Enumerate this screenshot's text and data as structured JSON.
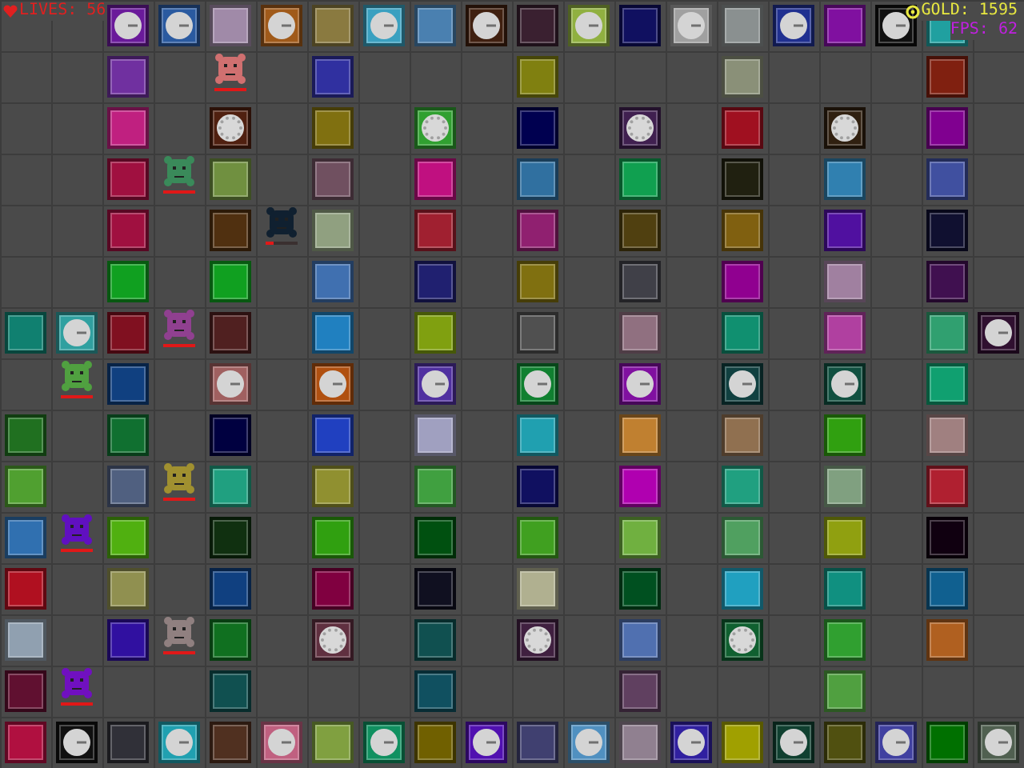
{
  "hud": {
    "lives": "LIVES: 56",
    "gold": "GOLD: 1595",
    "fps": "FPS: 62"
  },
  "grid": [
    [
      {
        "kind": "empty"
      },
      {
        "kind": "empty"
      },
      {
        "kind": "clock",
        "color": "#6a1a9a"
      },
      {
        "kind": "clock",
        "color": "#2a5aa0"
      },
      {
        "kind": "tile",
        "color": "#a08aa8"
      },
      {
        "kind": "clock",
        "color": "#a05a1a"
      },
      {
        "kind": "tile",
        "color": "#8a7a40"
      },
      {
        "kind": "clock",
        "color": "#3aa0c0"
      },
      {
        "kind": "tile",
        "color": "#4a80b0"
      },
      {
        "kind": "clock",
        "color": "#402010"
      },
      {
        "kind": "tile",
        "color": "#3a2030"
      },
      {
        "kind": "clock",
        "color": "#90b040"
      },
      {
        "kind": "tile",
        "color": "#101060"
      },
      {
        "kind": "clock",
        "color": "#a0a0a0"
      },
      {
        "kind": "tile",
        "color": "#8a9090"
      },
      {
        "kind": "clock",
        "color": "#203090"
      },
      {
        "kind": "tile",
        "color": "#8010a0"
      },
      {
        "kind": "clock",
        "color": "#101010"
      },
      {
        "kind": "tile",
        "color": "#20a0a0"
      },
      {
        "kind": "empty"
      }
    ],
    [
      {
        "kind": "empty"
      },
      {
        "kind": "empty"
      },
      {
        "kind": "tile",
        "color": "#7030a0"
      },
      {
        "kind": "empty"
      },
      {
        "kind": "empty",
        "creep": {
          "color": "#d07070",
          "level": 1
        }
      },
      {
        "kind": "empty"
      },
      {
        "kind": "tile",
        "color": "#3030a0"
      },
      {
        "kind": "empty"
      },
      {
        "kind": "empty"
      },
      {
        "kind": "empty"
      },
      {
        "kind": "tile",
        "color": "#808010"
      },
      {
        "kind": "empty"
      },
      {
        "kind": "empty"
      },
      {
        "kind": "empty"
      },
      {
        "kind": "tile",
        "color": "#8a9078"
      },
      {
        "kind": "empty"
      },
      {
        "kind": "empty"
      },
      {
        "kind": "empty"
      },
      {
        "kind": "tile",
        "color": "#802010"
      },
      {
        "kind": "empty"
      }
    ],
    [
      {
        "kind": "empty"
      },
      {
        "kind": "empty"
      },
      {
        "kind": "tile",
        "color": "#c02080"
      },
      {
        "kind": "empty"
      },
      {
        "kind": "dial",
        "color": "#502010"
      },
      {
        "kind": "empty"
      },
      {
        "kind": "tile",
        "color": "#807010"
      },
      {
        "kind": "empty"
      },
      {
        "kind": "dial",
        "color": "#30a030"
      },
      {
        "kind": "empty"
      },
      {
        "kind": "tile",
        "color": "#000050"
      },
      {
        "kind": "empty"
      },
      {
        "kind": "dial",
        "color": "#402050"
      },
      {
        "kind": "empty"
      },
      {
        "kind": "tile",
        "color": "#a01020"
      },
      {
        "kind": "empty"
      },
      {
        "kind": "dial",
        "color": "#302010"
      },
      {
        "kind": "empty"
      },
      {
        "kind": "tile",
        "color": "#800090"
      },
      {
        "kind": "empty"
      }
    ],
    [
      {
        "kind": "empty"
      },
      {
        "kind": "empty"
      },
      {
        "kind": "tile",
        "color": "#a01040"
      },
      {
        "kind": "empty",
        "creep": {
          "color": "#3a8a5a",
          "level": 1
        }
      },
      {
        "kind": "tile",
        "color": "#709040"
      },
      {
        "kind": "empty"
      },
      {
        "kind": "tile",
        "color": "#705060"
      },
      {
        "kind": "empty"
      },
      {
        "kind": "tile",
        "color": "#c01080"
      },
      {
        "kind": "empty"
      },
      {
        "kind": "tile",
        "color": "#3070a0"
      },
      {
        "kind": "empty"
      },
      {
        "kind": "tile",
        "color": "#10a050"
      },
      {
        "kind": "empty"
      },
      {
        "kind": "tile",
        "color": "#202010"
      },
      {
        "kind": "empty"
      },
      {
        "kind": "tile",
        "color": "#3080b0"
      },
      {
        "kind": "empty"
      },
      {
        "kind": "tile",
        "color": "#4050a0"
      },
      {
        "kind": "empty"
      }
    ],
    [
      {
        "kind": "empty"
      },
      {
        "kind": "empty"
      },
      {
        "kind": "tile",
        "color": "#a01040"
      },
      {
        "kind": "empty"
      },
      {
        "kind": "tile",
        "color": "#503010"
      },
      {
        "kind": "empty",
        "creep": {
          "color": "#102030",
          "level": 0.25
        }
      },
      {
        "kind": "tile",
        "color": "#90a080"
      },
      {
        "kind": "empty"
      },
      {
        "kind": "tile",
        "color": "#a02030"
      },
      {
        "kind": "empty"
      },
      {
        "kind": "tile",
        "color": "#902070"
      },
      {
        "kind": "empty"
      },
      {
        "kind": "tile",
        "color": "#504010"
      },
      {
        "kind": "empty"
      },
      {
        "kind": "tile",
        "color": "#806010"
      },
      {
        "kind": "empty"
      },
      {
        "kind": "tile",
        "color": "#5010a0"
      },
      {
        "kind": "empty"
      },
      {
        "kind": "tile",
        "color": "#101030"
      },
      {
        "kind": "empty"
      }
    ],
    [
      {
        "kind": "empty"
      },
      {
        "kind": "empty"
      },
      {
        "kind": "tile",
        "color": "#10a020"
      },
      {
        "kind": "empty"
      },
      {
        "kind": "tile",
        "color": "#10a020"
      },
      {
        "kind": "empty"
      },
      {
        "kind": "tile",
        "color": "#4070b0"
      },
      {
        "kind": "empty"
      },
      {
        "kind": "tile",
        "color": "#202070"
      },
      {
        "kind": "empty"
      },
      {
        "kind": "tile",
        "color": "#807010"
      },
      {
        "kind": "empty"
      },
      {
        "kind": "tile",
        "color": "#404048"
      },
      {
        "kind": "empty"
      },
      {
        "kind": "tile",
        "color": "#900090"
      },
      {
        "kind": "empty"
      },
      {
        "kind": "tile",
        "color": "#a080a0"
      },
      {
        "kind": "empty"
      },
      {
        "kind": "tile",
        "color": "#401050"
      },
      {
        "kind": "empty"
      }
    ],
    [
      {
        "kind": "tile",
        "color": "#108070"
      },
      {
        "kind": "clock",
        "color": "#30a0a0"
      },
      {
        "kind": "tile",
        "color": "#801020"
      },
      {
        "kind": "empty",
        "creep": {
          "color": "#904090",
          "level": 1
        }
      },
      {
        "kind": "tile",
        "color": "#502020"
      },
      {
        "kind": "empty"
      },
      {
        "kind": "tile",
        "color": "#2080c0"
      },
      {
        "kind": "empty"
      },
      {
        "kind": "tile",
        "color": "#80a010"
      },
      {
        "kind": "empty"
      },
      {
        "kind": "tile",
        "color": "#505050"
      },
      {
        "kind": "empty"
      },
      {
        "kind": "tile",
        "color": "#907080"
      },
      {
        "kind": "empty"
      },
      {
        "kind": "tile",
        "color": "#109070"
      },
      {
        "kind": "empty"
      },
      {
        "kind": "tile",
        "color": "#b040a0"
      },
      {
        "kind": "empty"
      },
      {
        "kind": "tile",
        "color": "#30a070"
      },
      {
        "kind": "clock",
        "color": "#301030"
      }
    ],
    [
      {
        "kind": "empty"
      },
      {
        "kind": "empty",
        "creep": {
          "color": "#50a040",
          "level": 1
        }
      },
      {
        "kind": "tile",
        "color": "#104080"
      },
      {
        "kind": "empty"
      },
      {
        "kind": "clock",
        "color": "#a06060"
      },
      {
        "kind": "empty"
      },
      {
        "kind": "clock",
        "color": "#b05010"
      },
      {
        "kind": "empty"
      },
      {
        "kind": "clock",
        "color": "#5030a0"
      },
      {
        "kind": "empty"
      },
      {
        "kind": "clock",
        "color": "#108030"
      },
      {
        "kind": "empty"
      },
      {
        "kind": "clock",
        "color": "#8010a0"
      },
      {
        "kind": "empty"
      },
      {
        "kind": "clock",
        "color": "#104040"
      },
      {
        "kind": "empty"
      },
      {
        "kind": "clock",
        "color": "#105040"
      },
      {
        "kind": "empty"
      },
      {
        "kind": "tile",
        "color": "#10a070"
      },
      {
        "kind": "empty"
      }
    ],
    [
      {
        "kind": "tile",
        "color": "#207020"
      },
      {
        "kind": "empty"
      },
      {
        "kind": "tile",
        "color": "#107030"
      },
      {
        "kind": "empty"
      },
      {
        "kind": "tile",
        "color": "#000040"
      },
      {
        "kind": "empty"
      },
      {
        "kind": "tile",
        "color": "#2040c0"
      },
      {
        "kind": "empty"
      },
      {
        "kind": "tile",
        "color": "#a0a0c0"
      },
      {
        "kind": "empty"
      },
      {
        "kind": "tile",
        "color": "#20a0b0"
      },
      {
        "kind": "empty"
      },
      {
        "kind": "tile",
        "color": "#c08030"
      },
      {
        "kind": "empty"
      },
      {
        "kind": "tile",
        "color": "#907050"
      },
      {
        "kind": "empty"
      },
      {
        "kind": "tile",
        "color": "#30a010"
      },
      {
        "kind": "empty"
      },
      {
        "kind": "tile",
        "color": "#a08080"
      },
      {
        "kind": "empty"
      }
    ],
    [
      {
        "kind": "tile",
        "color": "#50a030"
      },
      {
        "kind": "empty"
      },
      {
        "kind": "tile",
        "color": "#506080"
      },
      {
        "kind": "empty",
        "creep": {
          "color": "#a09030",
          "level": 1
        }
      },
      {
        "kind": "tile",
        "color": "#20a080"
      },
      {
        "kind": "empty"
      },
      {
        "kind": "tile",
        "color": "#909030"
      },
      {
        "kind": "empty"
      },
      {
        "kind": "tile",
        "color": "#40a040"
      },
      {
        "kind": "empty"
      },
      {
        "kind": "tile",
        "color": "#101060"
      },
      {
        "kind": "empty"
      },
      {
        "kind": "tile",
        "color": "#b000b0"
      },
      {
        "kind": "empty"
      },
      {
        "kind": "tile",
        "color": "#20a080"
      },
      {
        "kind": "empty"
      },
      {
        "kind": "tile",
        "color": "#80a080"
      },
      {
        "kind": "empty"
      },
      {
        "kind": "tile",
        "color": "#b02030"
      },
      {
        "kind": "empty"
      }
    ],
    [
      {
        "kind": "tile",
        "color": "#3070b0"
      },
      {
        "kind": "empty",
        "creep": {
          "color": "#6010c0",
          "level": 1
        }
      },
      {
        "kind": "tile",
        "color": "#50b010"
      },
      {
        "kind": "empty"
      },
      {
        "kind": "tile",
        "color": "#103010"
      },
      {
        "kind": "empty"
      },
      {
        "kind": "tile",
        "color": "#30a010"
      },
      {
        "kind": "empty"
      },
      {
        "kind": "tile",
        "color": "#005010"
      },
      {
        "kind": "empty"
      },
      {
        "kind": "tile",
        "color": "#40a020"
      },
      {
        "kind": "empty"
      },
      {
        "kind": "tile",
        "color": "#70b040"
      },
      {
        "kind": "empty"
      },
      {
        "kind": "tile",
        "color": "#50a060"
      },
      {
        "kind": "empty"
      },
      {
        "kind": "tile",
        "color": "#90a010"
      },
      {
        "kind": "empty"
      },
      {
        "kind": "tile",
        "color": "#100010"
      },
      {
        "kind": "empty"
      }
    ],
    [
      {
        "kind": "tile",
        "color": "#b01020"
      },
      {
        "kind": "empty"
      },
      {
        "kind": "tile",
        "color": "#909050"
      },
      {
        "kind": "empty"
      },
      {
        "kind": "tile",
        "color": "#104080"
      },
      {
        "kind": "empty"
      },
      {
        "kind": "tile",
        "color": "#800040"
      },
      {
        "kind": "empty"
      },
      {
        "kind": "tile",
        "color": "#101020"
      },
      {
        "kind": "empty"
      },
      {
        "kind": "tile",
        "color": "#b0b090"
      },
      {
        "kind": "empty"
      },
      {
        "kind": "tile",
        "color": "#005020"
      },
      {
        "kind": "empty"
      },
      {
        "kind": "tile",
        "color": "#20a0c0"
      },
      {
        "kind": "empty"
      },
      {
        "kind": "tile",
        "color": "#109080"
      },
      {
        "kind": "empty"
      },
      {
        "kind": "tile",
        "color": "#106090"
      },
      {
        "kind": "empty"
      }
    ],
    [
      {
        "kind": "tile",
        "color": "#90a0b0"
      },
      {
        "kind": "empty"
      },
      {
        "kind": "tile",
        "color": "#3010a0"
      },
      {
        "kind": "empty",
        "creep": {
          "color": "#908080",
          "level": 1
        }
      },
      {
        "kind": "tile",
        "color": "#107020"
      },
      {
        "kind": "empty"
      },
      {
        "kind": "dial",
        "color": "#603040"
      },
      {
        "kind": "empty"
      },
      {
        "kind": "tile",
        "color": "#105050"
      },
      {
        "kind": "empty"
      },
      {
        "kind": "dial",
        "color": "#402040"
      },
      {
        "kind": "empty"
      },
      {
        "kind": "tile",
        "color": "#5070b0"
      },
      {
        "kind": "empty"
      },
      {
        "kind": "dial",
        "color": "#106030"
      },
      {
        "kind": "empty"
      },
      {
        "kind": "tile",
        "color": "#30a030"
      },
      {
        "kind": "empty"
      },
      {
        "kind": "tile",
        "color": "#b06020"
      },
      {
        "kind": "empty"
      }
    ],
    [
      {
        "kind": "tile",
        "color": "#601030"
      },
      {
        "kind": "empty",
        "creep": {
          "color": "#7010c0",
          "level": 1
        }
      },
      {
        "kind": "empty"
      },
      {
        "kind": "empty"
      },
      {
        "kind": "tile",
        "color": "#105050"
      },
      {
        "kind": "empty"
      },
      {
        "kind": "empty"
      },
      {
        "kind": "empty"
      },
      {
        "kind": "tile",
        "color": "#105060"
      },
      {
        "kind": "empty"
      },
      {
        "kind": "empty"
      },
      {
        "kind": "empty"
      },
      {
        "kind": "tile",
        "color": "#604060"
      },
      {
        "kind": "empty"
      },
      {
        "kind": "empty"
      },
      {
        "kind": "empty"
      },
      {
        "kind": "tile",
        "color": "#50a040"
      },
      {
        "kind": "empty"
      },
      {
        "kind": "empty"
      },
      {
        "kind": "empty"
      }
    ],
    [
      {
        "kind": "tile",
        "color": "#b01040"
      },
      {
        "kind": "clock",
        "color": "#101010"
      },
      {
        "kind": "tile",
        "color": "#303038"
      },
      {
        "kind": "clock",
        "color": "#20a0b0"
      },
      {
        "kind": "tile",
        "color": "#503020"
      },
      {
        "kind": "clock",
        "color": "#c06080"
      },
      {
        "kind": "tile",
        "color": "#80a040"
      },
      {
        "kind": "clock",
        "color": "#109060"
      },
      {
        "kind": "tile",
        "color": "#706000"
      },
      {
        "kind": "clock",
        "color": "#5010b0"
      },
      {
        "kind": "tile",
        "color": "#404070"
      },
      {
        "kind": "clock",
        "color": "#5090c0"
      },
      {
        "kind": "tile",
        "color": "#908090"
      },
      {
        "kind": "clock",
        "color": "#3020a0"
      },
      {
        "kind": "tile",
        "color": "#a0a000"
      },
      {
        "kind": "clock",
        "color": "#104030"
      },
      {
        "kind": "tile",
        "color": "#505010"
      },
      {
        "kind": "clock",
        "color": "#4040a0"
      },
      {
        "kind": "tile",
        "color": "#007000"
      },
      {
        "kind": "clock",
        "color": "#506050"
      }
    ]
  ]
}
